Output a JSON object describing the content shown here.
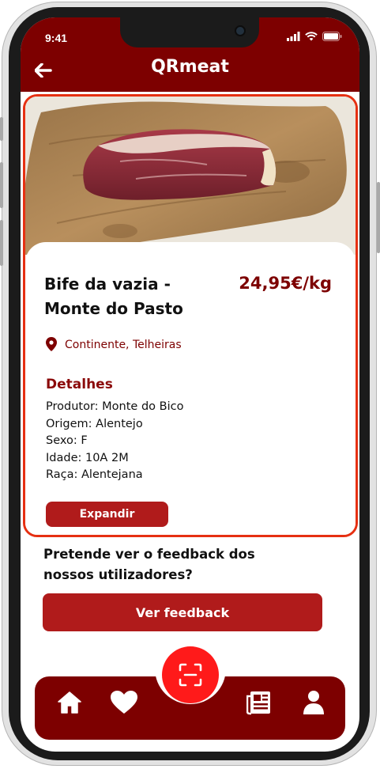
{
  "status_bar": {
    "time": "9:41"
  },
  "header": {
    "title": "QRmeat"
  },
  "product": {
    "name": "Bife da vazia - Monte do Pasto",
    "price": "24,95€/kg",
    "location": "Continente, Telheiras",
    "details_heading": "Detalhes",
    "details": [
      "Produtor: Monte do Bico",
      "Origem: Alentejo",
      "Sexo: F",
      "Idade: 10A 2M",
      "Raça: Alentejana"
    ],
    "expand_label": "Expandir"
  },
  "feedback": {
    "question": "Pretende ver o feedback dos nossos utilizadores?",
    "button_label": "Ver feedback"
  },
  "bottom_nav": {
    "items": [
      "home-icon",
      "heart-icon",
      "scan-qr-icon",
      "newspaper-icon",
      "user-icon"
    ]
  },
  "colors": {
    "brand_dark": "#7d0000",
    "button": "#b01b1b",
    "scan_button": "#ff1a1a",
    "card_border": "#e63012"
  }
}
